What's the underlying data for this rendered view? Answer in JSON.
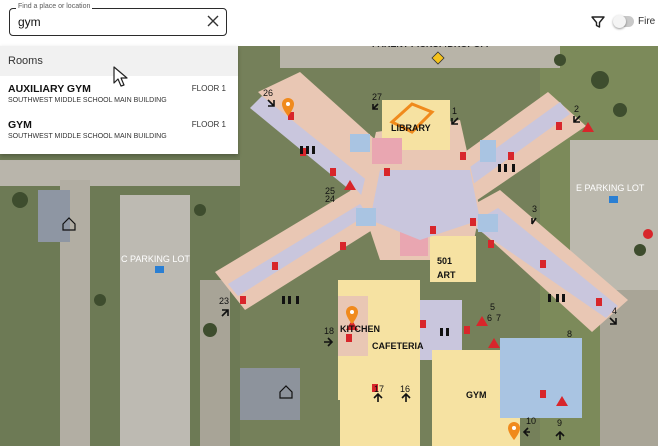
{
  "search": {
    "legend": "Find a place or location",
    "value": "gym"
  },
  "toolbar": {
    "toggle_label": "Fire"
  },
  "results": {
    "header": "Rooms",
    "items": [
      {
        "name": "AUXILIARY GYM",
        "building": "SOUTHWEST MIDDLE SCHOOL MAIN BUILDING",
        "floor": "FLOOR 1"
      },
      {
        "name": "GYM",
        "building": "SOUTHWEST MIDDLE SCHOOL MAIN BUILDING",
        "floor": "FLOOR 1"
      }
    ]
  },
  "map": {
    "labels": {
      "parent_dropoff": "PARENT PICKUP/DROPOFF",
      "library": "LIBRARY",
      "e_parking": "E PARKING LOT",
      "c_parking": "C PARKING LOT",
      "art_number": "501",
      "art": "ART",
      "kitchen": "KITCHEN",
      "cafeteria": "CAFETERIA",
      "gym": "GYM"
    },
    "exit_numbers": {
      "n1": "1",
      "n2": "2",
      "n3": "3",
      "n4": "4",
      "n5": "5",
      "n6": "6",
      "n7": "7",
      "n8": "8",
      "n9": "9",
      "n10": "10",
      "n16": "16",
      "n17": "17",
      "n18": "18",
      "n23": "23",
      "n24": "24",
      "n25": "25",
      "n26": "26",
      "n27": "27"
    },
    "colors": {
      "room": "#e9c7b4",
      "corridor": "#c9c6dd",
      "yellow_room": "#f6e2a2",
      "blue_room": "#a9c4e2",
      "pink_room": "#e9a6b1",
      "red_marker": "#d8262b",
      "orange_pin": "#f08a1c"
    }
  }
}
